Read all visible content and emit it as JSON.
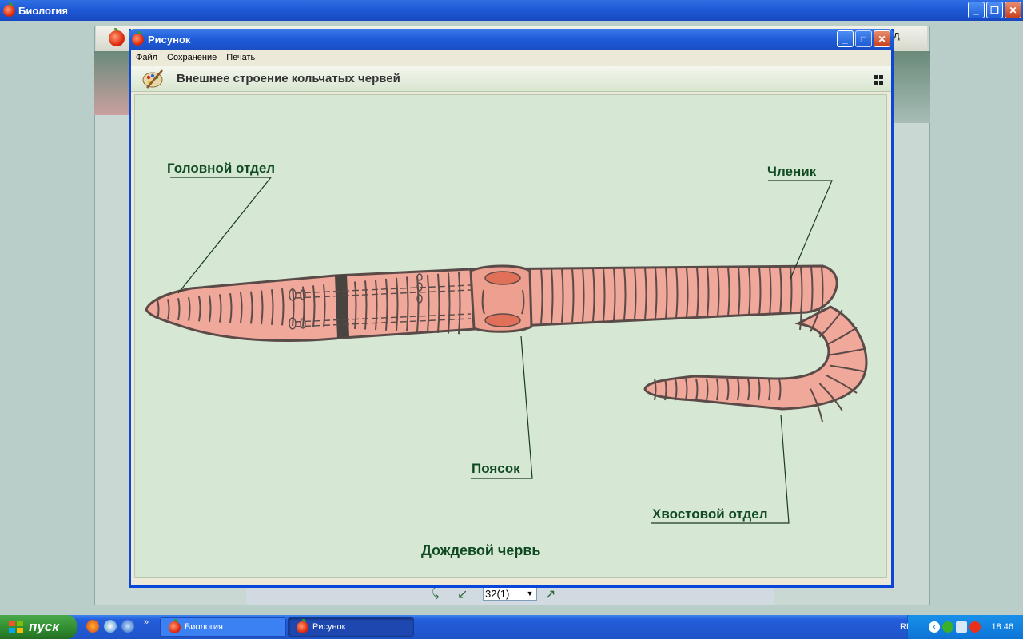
{
  "app_window": {
    "title": "Биология",
    "controls": {
      "minimize": "_",
      "maximize": "❐",
      "close": "✕"
    }
  },
  "navigation": {
    "page_value": "32(1)",
    "right_button_partial": "д"
  },
  "dialog": {
    "title": "Рисунок",
    "controls": {
      "minimize": "_",
      "maximize": "□",
      "close": "✕"
    },
    "menu": [
      "Файл",
      "Сохранение",
      "Печать"
    ],
    "heading": "Внешнее строение кольчатых червей",
    "labels": {
      "head": "Головной отдел",
      "segment": "Членик",
      "girdle": "Поясок",
      "tail": "Хвостовой отдел",
      "caption": "Дождевой червь"
    }
  },
  "taskbar": {
    "start_label": "пуск",
    "tasks": [
      "Биология",
      "Рисунок"
    ],
    "language": "RL",
    "clock": "18:46"
  },
  "colors": {
    "worm_body": "#f0a89a",
    "worm_outline": "#5a4a48",
    "canvas_bg": "#d6e7d3",
    "label_text": "#0f4a22",
    "xp_blue": "#1d5bd8"
  }
}
